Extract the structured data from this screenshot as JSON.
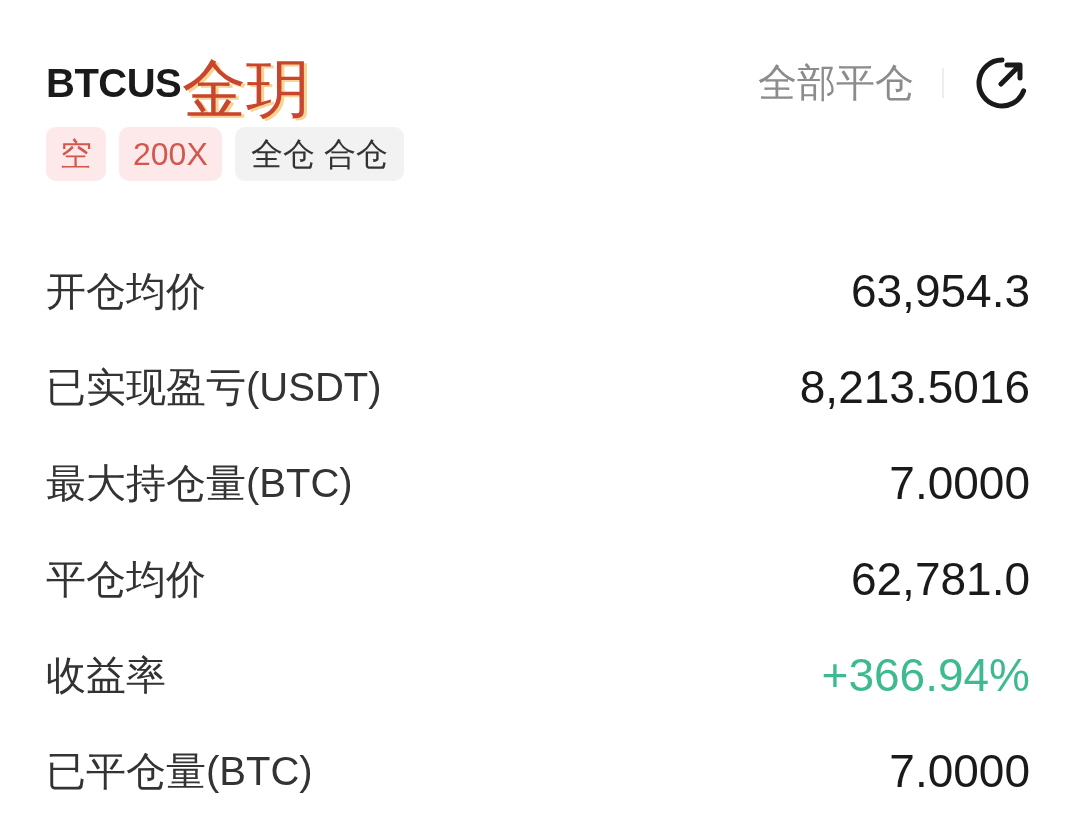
{
  "header": {
    "title": "BTCUS",
    "sticker": "金玥",
    "close_all_button": "全部平仓"
  },
  "tags": [
    {
      "text": "空",
      "kind": "danger"
    },
    {
      "text": "200X",
      "kind": "danger"
    },
    {
      "text": "全仓 合仓",
      "kind": "neutral"
    }
  ],
  "rows": [
    {
      "label": "开仓均价",
      "value": "63,954.3",
      "color": "#1a1a1a"
    },
    {
      "label": "已实现盈亏(USDT)",
      "value": "8,213.5016",
      "color": "#1a1a1a"
    },
    {
      "label": "最大持仓量(BTC)",
      "value": "7.0000",
      "color": "#1a1a1a"
    },
    {
      "label": "平仓均价",
      "value": "62,781.0",
      "color": "#1a1a1a"
    },
    {
      "label": "收益率",
      "value": "+366.94%",
      "color": "#3dba8f"
    },
    {
      "label": "已平仓量(BTC)",
      "value": "7.0000",
      "color": "#1a1a1a"
    }
  ]
}
